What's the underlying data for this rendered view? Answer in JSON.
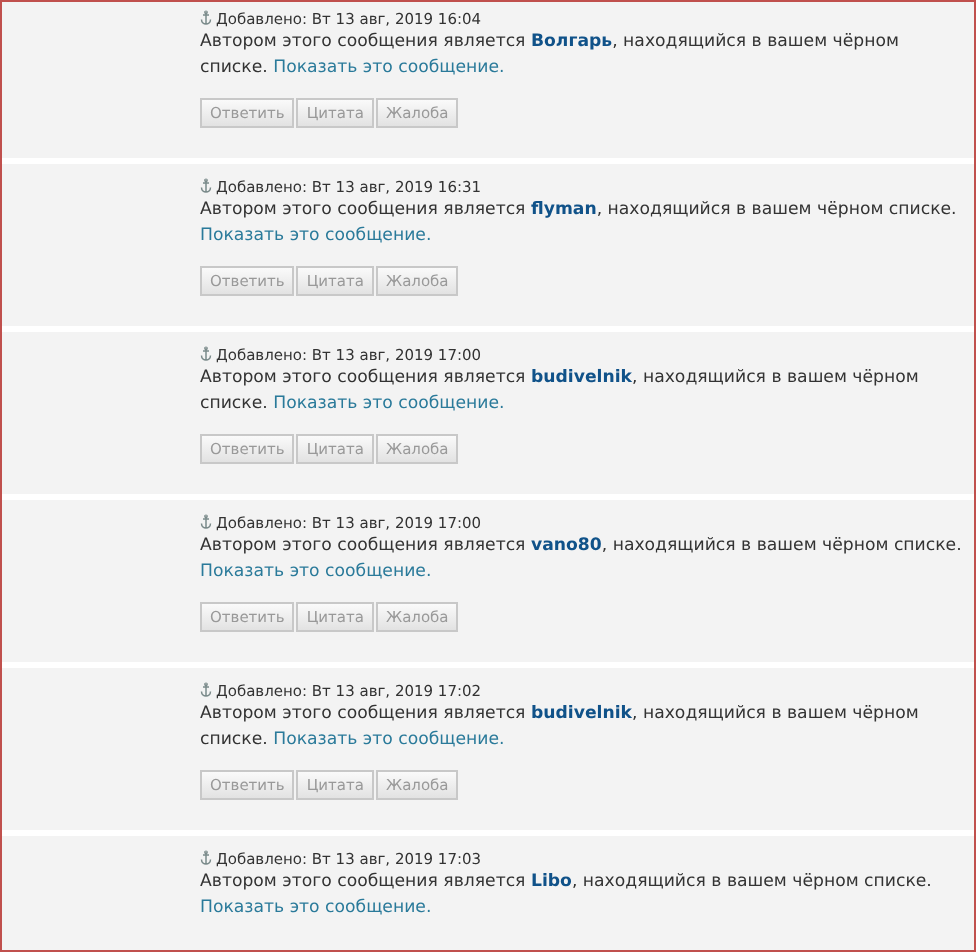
{
  "posts": [
    {
      "added": "Добавлено: Вт 13 авг, 2019 16:04",
      "before": "Автором этого сообщения является ",
      "author": "Волгарь",
      "after": ", находящийся в вашем чёрном списке. ",
      "link": "Показать это сообщение.",
      "buttons": [
        "Ответить",
        "Цитата",
        "Жалоба"
      ]
    },
    {
      "added": "Добавлено: Вт 13 авг, 2019 16:31",
      "before": "Автором этого сообщения является ",
      "author": "flyman",
      "after": ", находящийся в вашем чёрном списке. ",
      "link": "Показать это сообщение.",
      "buttons": [
        "Ответить",
        "Цитата",
        "Жалоба"
      ]
    },
    {
      "added": "Добавлено: Вт 13 авг, 2019 17:00",
      "before": "Автором этого сообщения является ",
      "author": "budivelnik",
      "after": ", находящийся в вашем чёрном списке. ",
      "link": "Показать это сообщение.",
      "buttons": [
        "Ответить",
        "Цитата",
        "Жалоба"
      ]
    },
    {
      "added": "Добавлено: Вт 13 авг, 2019 17:00",
      "before": "Автором этого сообщения является ",
      "author": "vano80",
      "after": ", находящийся в вашем чёрном списке. ",
      "link": "Показать это сообщение.",
      "buttons": [
        "Ответить",
        "Цитата",
        "Жалоба"
      ]
    },
    {
      "added": "Добавлено: Вт 13 авг, 2019 17:02",
      "before": "Автором этого сообщения является ",
      "author": "budivelnik",
      "after": ", находящийся в вашем чёрном списке. ",
      "link": "Показать это сообщение.",
      "buttons": [
        "Ответить",
        "Цитата",
        "Жалоба"
      ]
    },
    {
      "added": "Добавлено: Вт 13 авг, 2019 17:03",
      "before": "Автором этого сообщения является ",
      "author": "Libo",
      "after": ", находящийся в вашем чёрном списке. ",
      "link": "Показать это сообщение."
    }
  ]
}
